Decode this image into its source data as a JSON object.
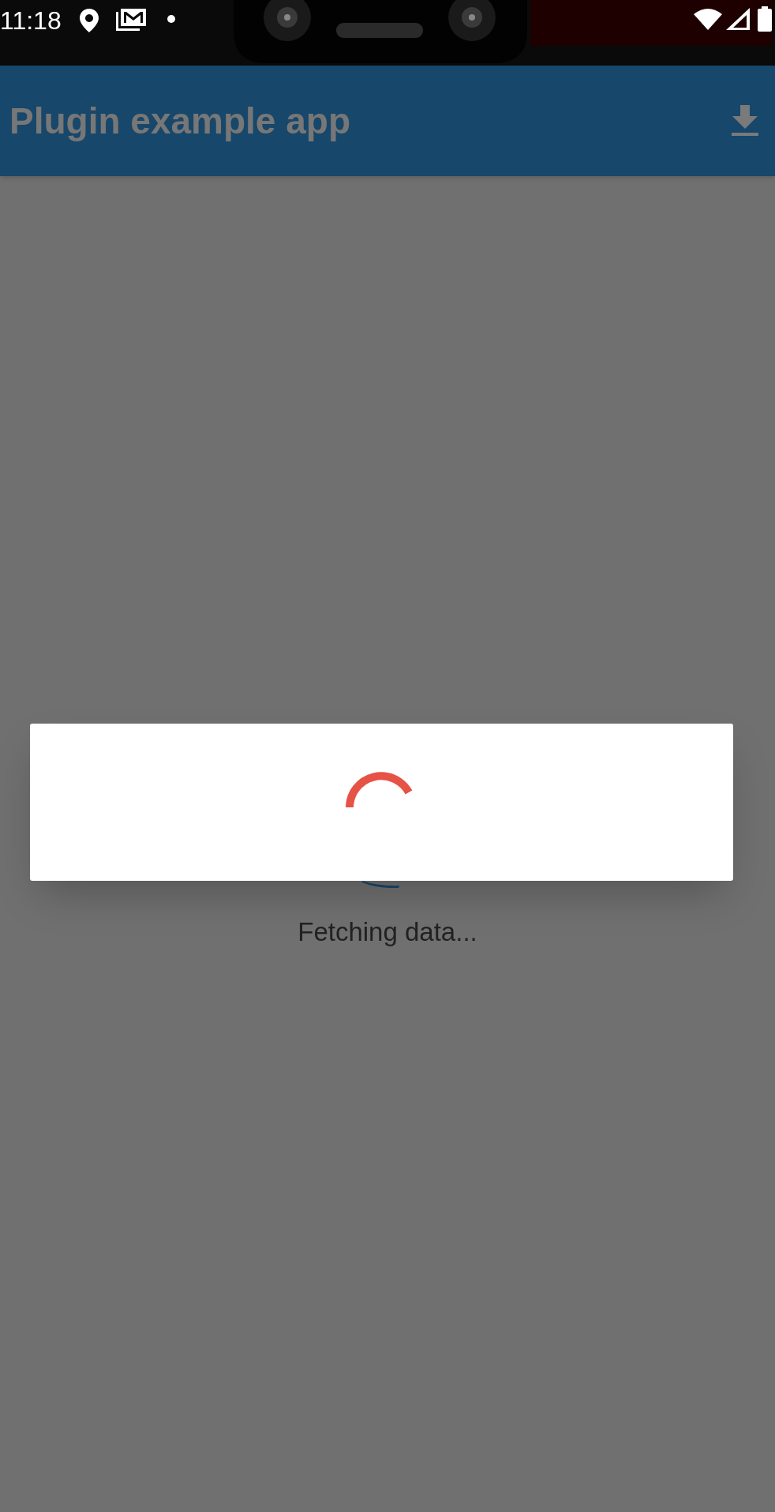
{
  "status_bar": {
    "time": "11:18"
  },
  "app_bar": {
    "title": "Plugin example app"
  },
  "body": {
    "message": "Fetching data..."
  }
}
